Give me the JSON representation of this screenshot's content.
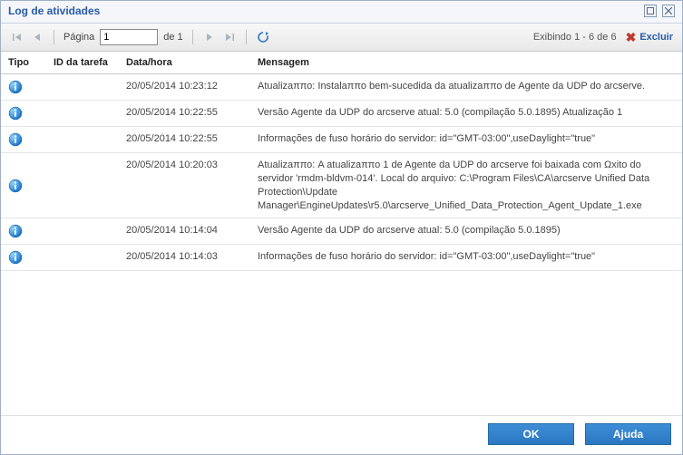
{
  "window": {
    "title": "Log de atividades"
  },
  "toolbar": {
    "page_label_prefix": "Página",
    "page_value": "1",
    "page_label_suffix": "de 1",
    "display_text": "Exibindo 1 - 6 de 6",
    "excluir_label": "Excluir"
  },
  "columns": {
    "tipo": "Tipo",
    "id": "ID da tarefa",
    "data": "Data/hora",
    "msg": "Mensagem"
  },
  "rows": [
    {
      "tipo": "info",
      "id": "",
      "data": "20/05/2014 10:23:12",
      "msg": "Atualizaππο: Instalaππο bem-sucedida da atualizaππο de Agente da UDP do arcserve."
    },
    {
      "tipo": "info",
      "id": "",
      "data": "20/05/2014 10:22:55",
      "msg": "Versão Agente da UDP do arcserve atual: 5.0 (compilação 5.0.1895) Atualização 1"
    },
    {
      "tipo": "info",
      "id": "",
      "data": "20/05/2014 10:22:55",
      "msg": "Informações de fuso horário do servidor: id=\"GMT-03:00\",useDaylight=\"true\""
    },
    {
      "tipo": "info",
      "id": "",
      "data": "20/05/2014 10:20:03",
      "msg": "Atualizaππο: A atualizaππο 1 de Agente da UDP do arcserve foi baixada com Ωxito do servidor 'rmdm-bldvm-014'. Local do arquivo: C:\\Program Files\\CA\\arcserve Unified Data Protection\\Update Manager\\EngineUpdates\\r5.0\\arcserve_Unified_Data_Protection_Agent_Update_1.exe"
    },
    {
      "tipo": "info",
      "id": "",
      "data": "20/05/2014 10:14:04",
      "msg": "Versão Agente da UDP do arcserve atual: 5.0 (compilação 5.0.1895)"
    },
    {
      "tipo": "info",
      "id": "",
      "data": "20/05/2014 10:14:03",
      "msg": "Informações de fuso horário do servidor: id=\"GMT-03:00\",useDaylight=\"true\""
    }
  ],
  "footer": {
    "ok_label": "OK",
    "help_label": "Ajuda"
  }
}
